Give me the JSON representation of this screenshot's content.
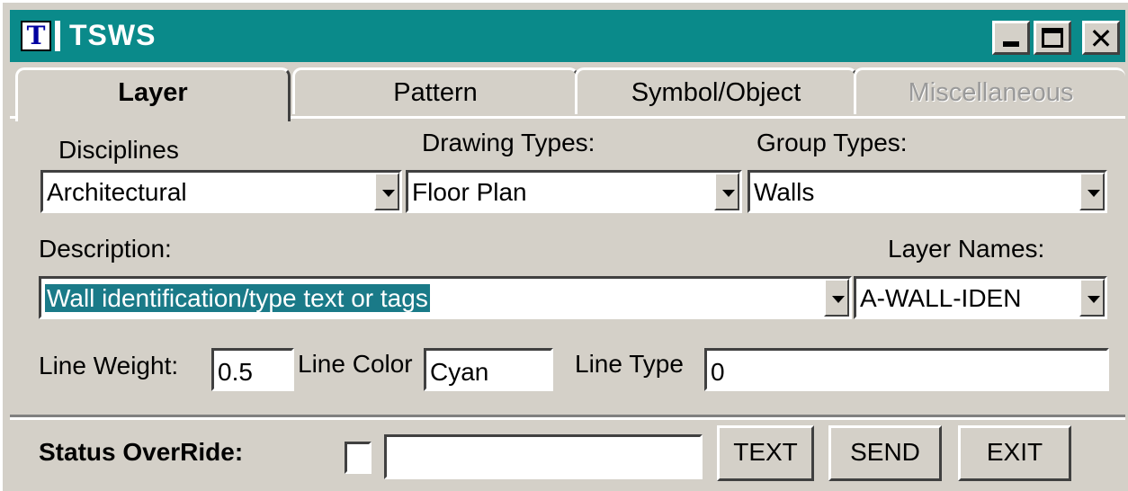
{
  "window": {
    "title": "TSWS",
    "icon": "tsws-app-icon",
    "icon_letter": "T",
    "title_bar_color": "#0a8a8a",
    "controls": {
      "minimize": "minimize-icon",
      "maximize": "maximize-icon",
      "close_glyph": "✕"
    }
  },
  "tabs": [
    {
      "label": "Layer",
      "state": "active"
    },
    {
      "label": "Pattern",
      "state": "normal"
    },
    {
      "label": "Symbol/Object",
      "state": "normal"
    },
    {
      "label": "Miscellaneous",
      "state": "disabled"
    }
  ],
  "layer": {
    "disciplines": {
      "label": "Disciplines",
      "value": "Architectural"
    },
    "drawing_types": {
      "label": "Drawing Types:",
      "value": "Floor Plan"
    },
    "group_types": {
      "label": "Group Types:",
      "value": "Walls"
    },
    "description": {
      "label": "Description:",
      "value": "Wall identification/type text or tags"
    },
    "layer_names": {
      "label": "Layer Names:",
      "value": "A-WALL-IDEN"
    },
    "line_weight": {
      "label": "Line Weight:",
      "value": "0.5"
    },
    "line_color": {
      "label": "Line Color",
      "value": "Cyan"
    },
    "line_type": {
      "label": "Line Type",
      "value": "0"
    }
  },
  "footer": {
    "status_override_label": "Status OverRide:",
    "status_override_checked": false,
    "status_override_value": "",
    "buttons": {
      "text": "TEXT",
      "send": "SEND",
      "exit": "EXIT"
    }
  }
}
